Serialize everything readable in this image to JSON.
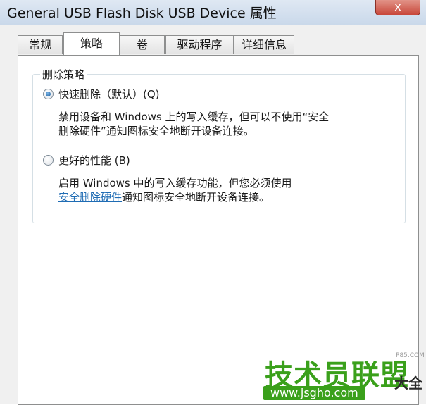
{
  "window": {
    "title": "General USB Flash Disk USB Device 属性",
    "close_glyph": "x"
  },
  "tabs": [
    {
      "label": "常规"
    },
    {
      "label": "策略",
      "active": true
    },
    {
      "label": "卷"
    },
    {
      "label": "驱动程序"
    },
    {
      "label": "详细信息"
    }
  ],
  "removal_policy": {
    "group_label": "删除策略",
    "quick_removal": {
      "label": "快速删除（默认）(Q)",
      "checked": true,
      "description_line1": "禁用设备和 Windows 上的写入缓存，但可以不使用“安全",
      "description_line2": "删除硬件”通知图标安全地断开设备连接。"
    },
    "better_performance": {
      "label": "更好的性能 (B)",
      "checked": false,
      "description_line1": "启用 Windows 中的写入缓存功能，但您必须使用",
      "description_link": "安全删除硬件",
      "description_line2_rest": "通知图标安全地断开设备连接。"
    }
  },
  "watermark": {
    "main": "技术员联盟",
    "side": "大全",
    "url": "www.jsgho.com",
    "small": "P85.COM"
  },
  "colors": {
    "link": "#1f6cb4",
    "watermark_green": "#3aa01b"
  }
}
